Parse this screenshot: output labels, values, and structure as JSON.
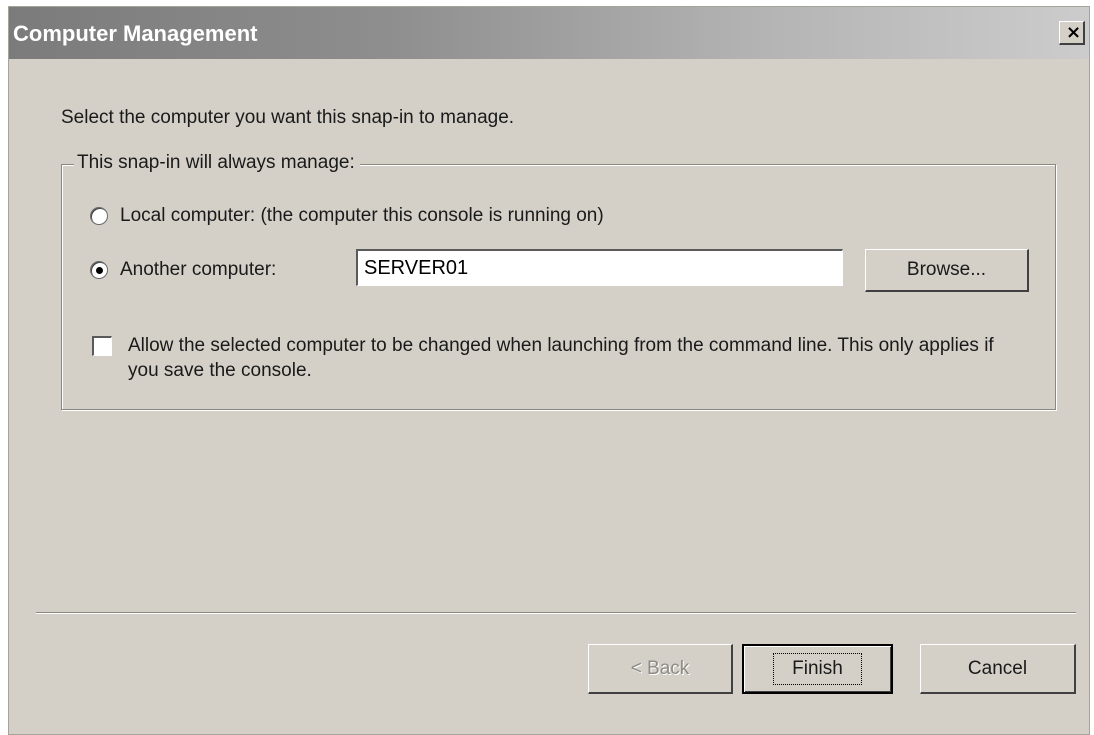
{
  "window": {
    "title": "Computer Management",
    "close_label": "×"
  },
  "instruction": "Select the computer you want this snap-in to manage.",
  "group": {
    "legend": "This snap-in will always manage:",
    "local_option": {
      "label": "Local computer:  (the computer this console is running on)",
      "selected": false
    },
    "another_option": {
      "label": "Another computer:",
      "selected": true,
      "value": "SERVER01"
    },
    "browse_label": "Browse...",
    "allow_change": {
      "label": "Allow the selected computer to be changed when launching from the command line.  This only applies if you save the console.",
      "checked": false
    }
  },
  "buttons": {
    "back": "< Back",
    "finish": "Finish",
    "cancel": "Cancel"
  }
}
